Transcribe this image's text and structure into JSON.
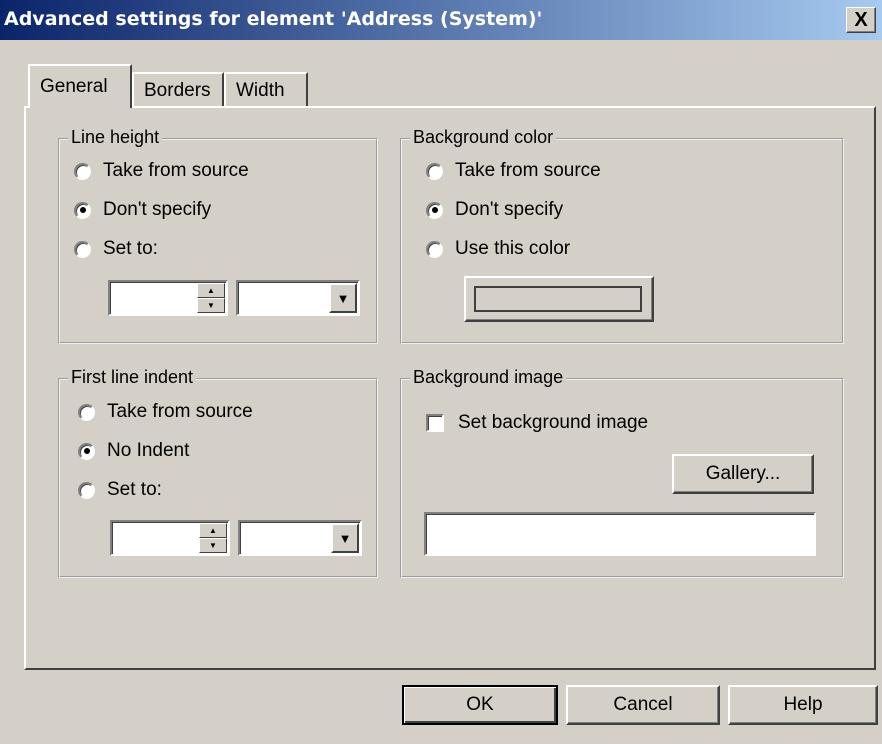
{
  "window": {
    "title": "Advanced settings for element 'Address (System)'",
    "close_glyph": "X"
  },
  "tabs": [
    {
      "label": "General",
      "active": true
    },
    {
      "label": "Borders",
      "active": false
    },
    {
      "label": "Width",
      "active": false
    }
  ],
  "line_height": {
    "label": "Line height",
    "options": [
      "Take from source",
      "Don't specify",
      "Set to:"
    ],
    "selected": 1,
    "value": ""
  },
  "first_line_indent": {
    "label": "First line indent",
    "options": [
      "Take from source",
      "No Indent",
      "Set to:"
    ],
    "selected": 1,
    "value": ""
  },
  "background_color": {
    "label": "Background color",
    "options": [
      "Take from source",
      "Don't specify",
      "Use this color"
    ],
    "selected": 1,
    "swatch_color": "#d4d0c8"
  },
  "background_image": {
    "label": "Background image",
    "checkbox_label": "Set background image",
    "checked": false,
    "gallery_label": "Gallery...",
    "path_value": ""
  },
  "footer": {
    "ok_label": "OK",
    "cancel_label": "Cancel",
    "help_label": "Help"
  }
}
